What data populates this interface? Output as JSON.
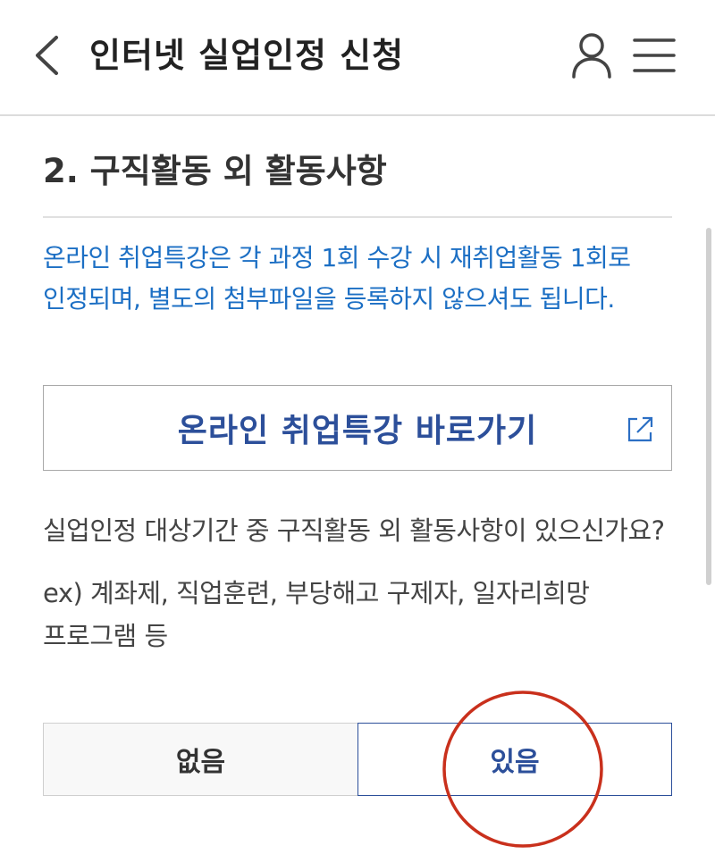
{
  "header": {
    "title": "인터넷 실업인정 신청",
    "back_icon": "chevron-left-icon",
    "user_icon": "user-icon",
    "menu_icon": "hamburger-menu-icon"
  },
  "section": {
    "title": "2. 구직활동 외 활동사항",
    "notice": "온라인 취업특강은 각 과정 1회 수강 시 재취업활동 1회로 인정되며, 별도의 첨부파일을 등록하지 않으셔도 됩니다.",
    "link_button": {
      "label": "온라인 취업특강 바로가기",
      "icon": "external-link-icon"
    },
    "question": "실업인정 대상기간 중 구직활동 외 활동사항이 있으신가요?",
    "example": "ex) 계좌제, 직업훈련, 부당해고 구제자, 일자리희망 프로그램 등",
    "options": {
      "none_label": "없음",
      "yes_label": "있음",
      "selected": "있음"
    }
  },
  "colors": {
    "notice_text": "#1c6fc4",
    "primary": "#2c4f9a",
    "annotation_circle": "#c9301c",
    "divider": "#dcdcdc"
  }
}
